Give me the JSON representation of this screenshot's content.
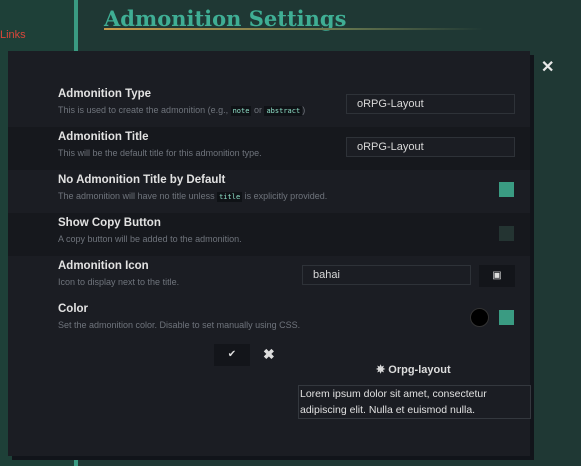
{
  "background": {
    "side_link": "Links",
    "page_title": "Admonition Settings"
  },
  "modal": {
    "close": "✕",
    "type": {
      "label": "Admonition Type",
      "desc_before": "This is used to create the admonition (e.g., ",
      "code1": "note",
      "desc_mid": " or ",
      "code2": "abstract",
      "desc_after": ")",
      "value": "oRPG-Layout"
    },
    "title": {
      "label": "Admonition Title",
      "desc": "This will be the default title for this admonition type.",
      "value": "oRPG-Layout"
    },
    "no_title": {
      "label": "No Admonition Title by Default",
      "desc_before": "The admonition will have no title unless ",
      "code": "title",
      "desc_after": " is explicitly provided.",
      "checked": true
    },
    "copy": {
      "label": "Show Copy Button",
      "desc": "A copy button will be added to the admonition.",
      "checked": false
    },
    "icon": {
      "label": "Admonition Icon",
      "desc": "Icon to display next to the title.",
      "value": "bahai",
      "button_icon": "image-icon"
    },
    "color": {
      "label": "Color",
      "desc": "Set the admonition color. Disable to set manually using CSS.",
      "swatch": "#000000",
      "enabled": true,
      "accent": "#3a9b82"
    },
    "save": "✔",
    "cancel": "✖",
    "preview": {
      "title": "Orpg-layout",
      "icon": "bahai-icon",
      "body": "Lorem ipsum dolor sit amet, consectetur adipiscing elit. Nulla et euismod nulla."
    }
  }
}
